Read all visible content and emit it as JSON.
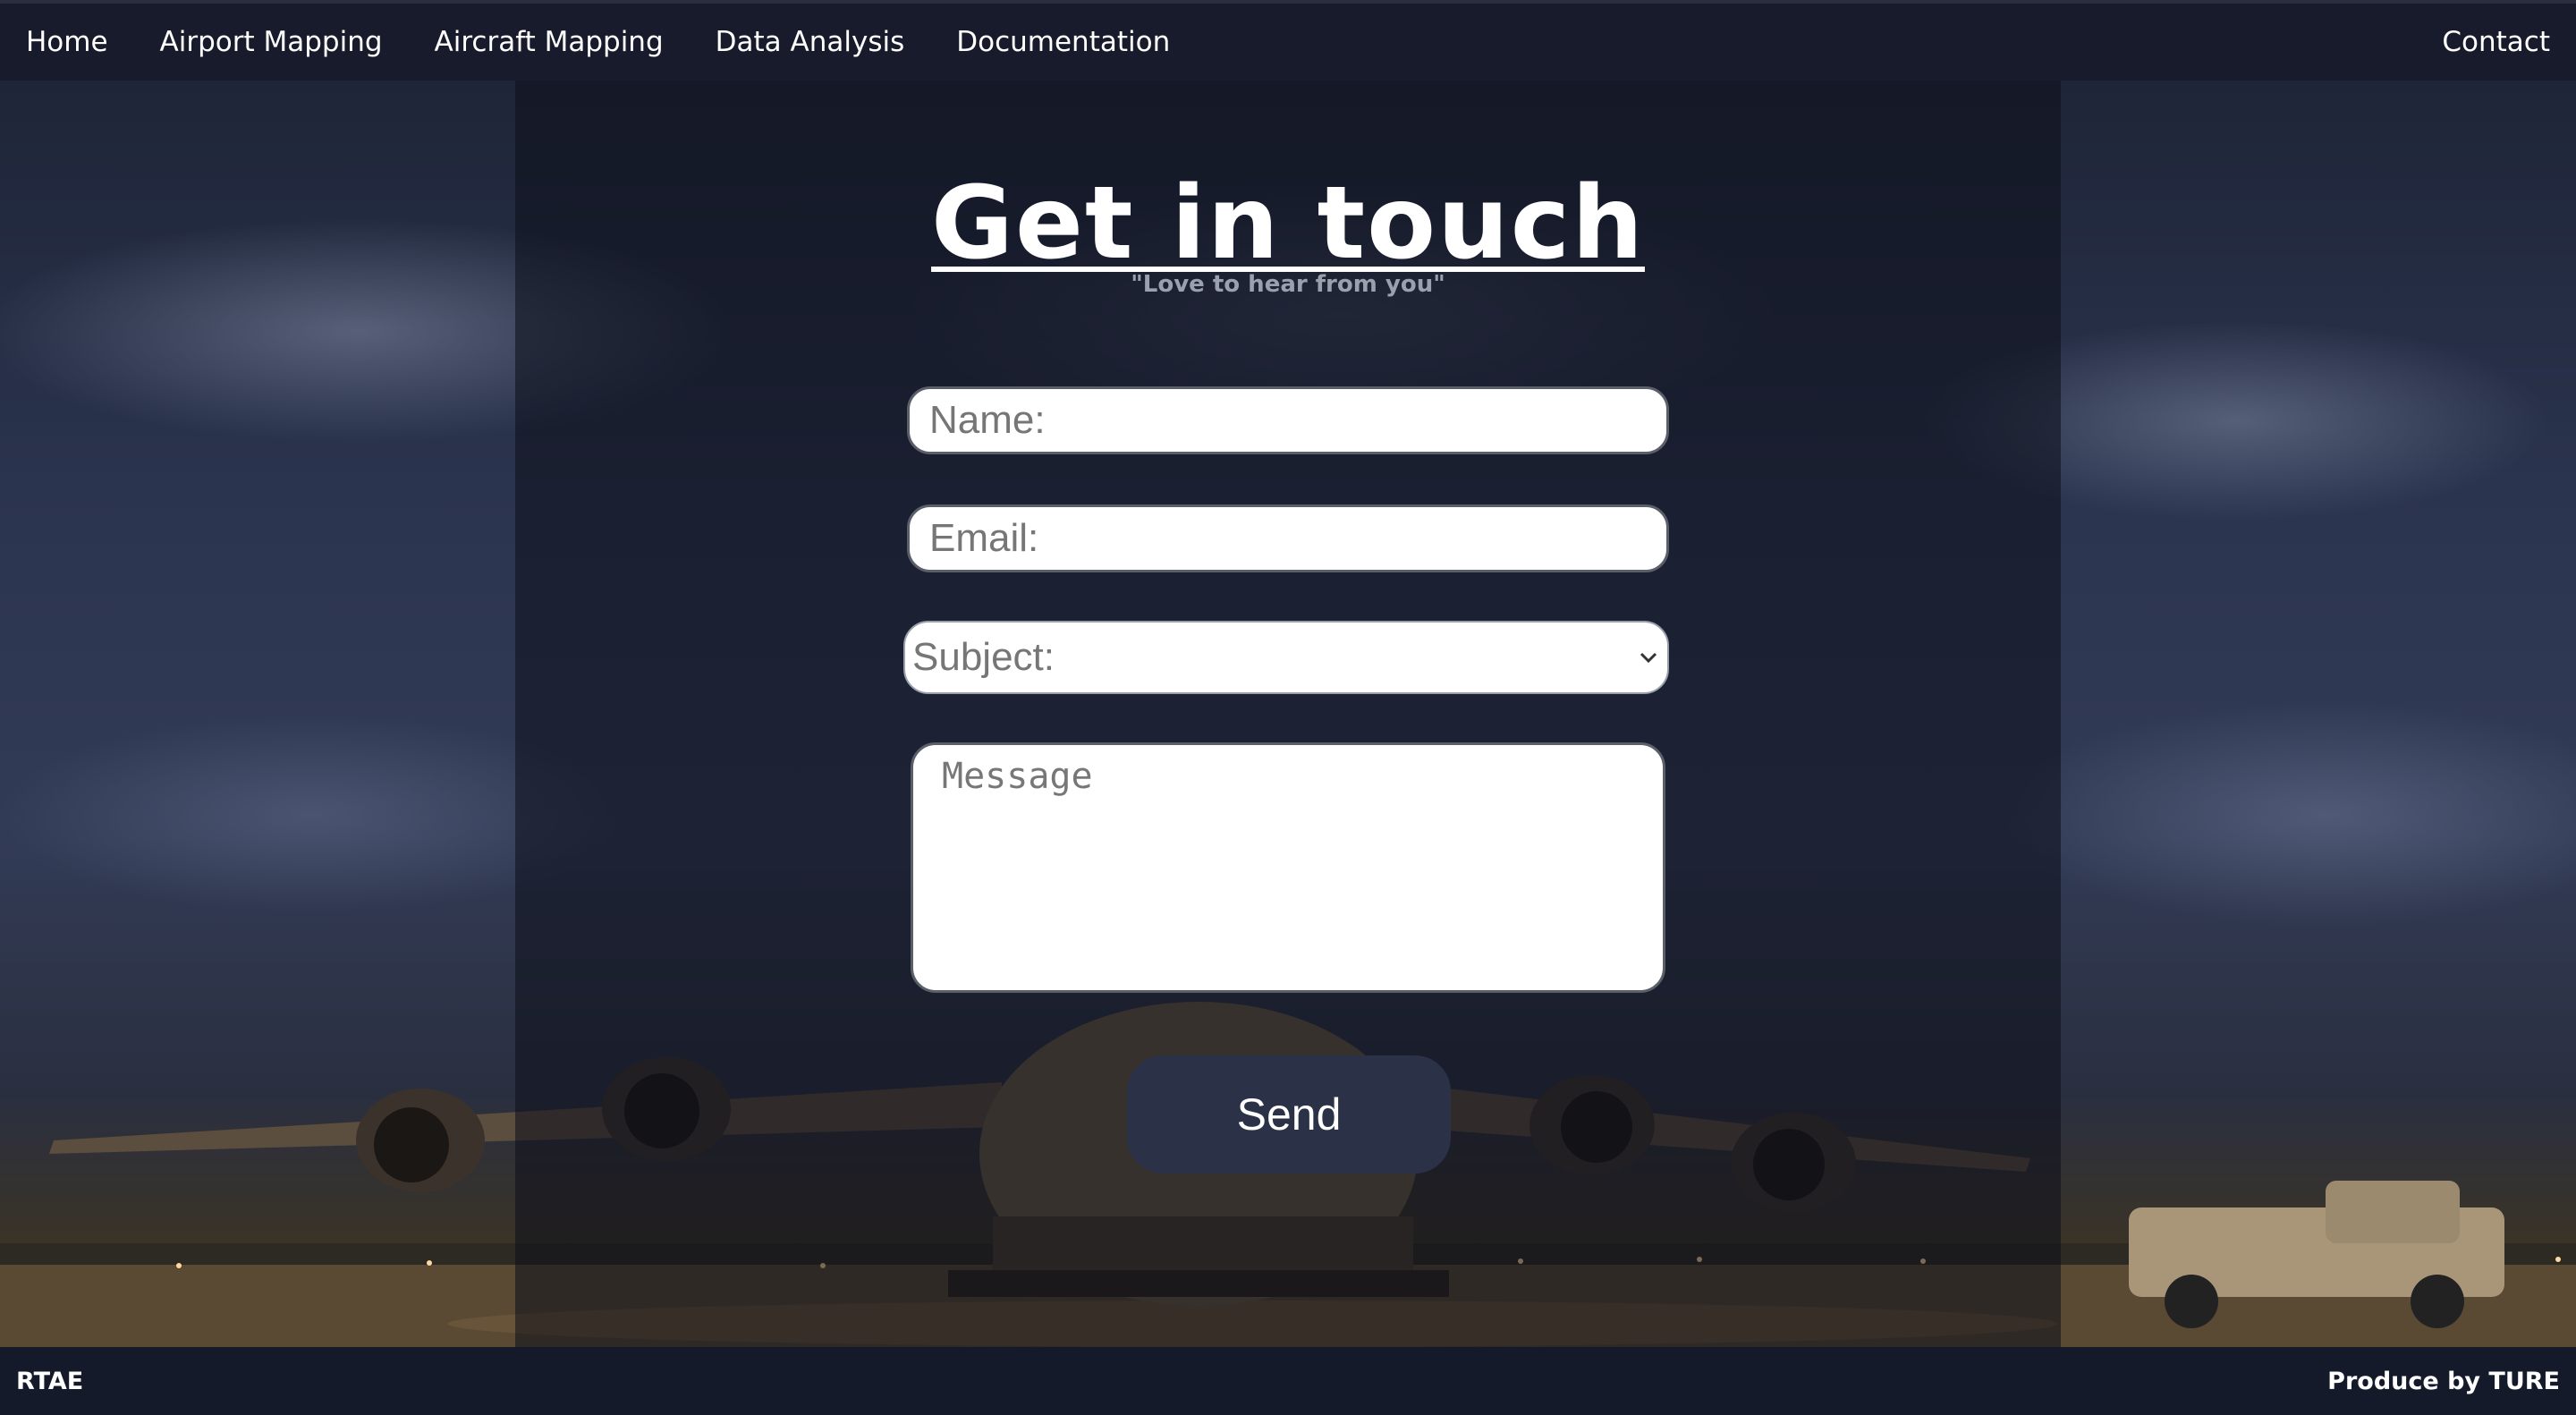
{
  "nav": {
    "items": [
      {
        "label": "Home"
      },
      {
        "label": "Airport Mapping"
      },
      {
        "label": "Aircraft Mapping"
      },
      {
        "label": "Data Analysis"
      },
      {
        "label": "Documentation"
      }
    ],
    "contact": "Contact"
  },
  "contact_form": {
    "title": "Get in touch",
    "subtitle": "\"Love to hear from you\"",
    "name_placeholder": "Name:",
    "email_placeholder": "Email:",
    "subject_value": "Subject:",
    "message_placeholder": "Message",
    "send_label": "Send"
  },
  "footer": {
    "left": "RTAE",
    "right": "Produce by TURE"
  },
  "colors": {
    "nav_bg": "#171b2b",
    "footer_bg": "#151a2a",
    "button_bg": "#2b3146"
  }
}
